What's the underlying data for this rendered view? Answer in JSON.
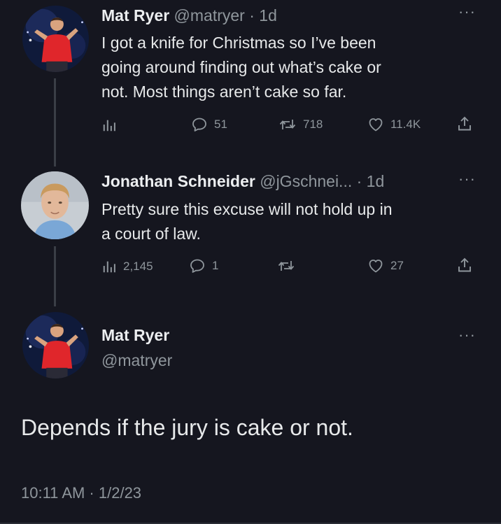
{
  "tweets": [
    {
      "name": "Mat Ryer",
      "handle_time": "@matryer · 1d",
      "text_lines": [
        "I got a knife for Christmas so I’ve been",
        "going around finding out what’s cake or",
        "not. Most things aren’t cake so far."
      ],
      "replies": "51",
      "retweets": "718",
      "likes": "11.4K"
    },
    {
      "name": "Jonathan Schneider",
      "handle_time": "@jGschnei... · 1d",
      "text_lines": [
        "Pretty sure this excuse will not hold up in",
        "a court of law."
      ],
      "views": "2,145",
      "replies": "1",
      "likes": "27"
    }
  ],
  "main_tweet": {
    "name": "Mat Ryer",
    "handle": "@matryer",
    "text": "Depends if the jury is cake or not.",
    "timestamp": "10:11 AM · 1/2/23"
  },
  "icons": {
    "more": "more-options-icon",
    "analytics": "analytics-icon",
    "reply": "reply-icon",
    "retweet": "retweet-icon",
    "like": "like-icon",
    "share": "share-icon"
  },
  "colors": {
    "background": "#15161f",
    "muted": "#8f969c",
    "text": "#e7e9ea"
  }
}
